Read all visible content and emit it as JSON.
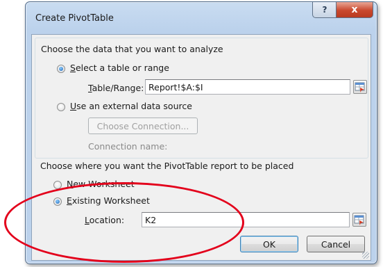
{
  "window": {
    "title": "Create PivotTable",
    "help_glyph": "?",
    "close_glyph": "x"
  },
  "source_section": {
    "heading": "Choose the data that you want to analyze",
    "option_table": {
      "accelerator": "S",
      "label_rest": "elect a table or range",
      "checked": true
    },
    "table_range": {
      "accelerator": "T",
      "label_rest": "able/Range:",
      "value": "Report!$A:$I"
    },
    "option_external": {
      "accelerator": "U",
      "label_rest": "se an external data source",
      "checked": false
    },
    "choose_connection_button": "Choose Connection...",
    "connection_name_label": "Connection name:"
  },
  "placement_section": {
    "heading": "Choose where you want the PivotTable report to be placed",
    "option_new": {
      "accelerator": "N",
      "label_rest": "ew Worksheet",
      "checked": false
    },
    "option_existing": {
      "accelerator": "E",
      "label_rest": "xisting Worksheet",
      "checked": true
    },
    "location": {
      "accelerator": "L",
      "label_rest": "ocation:",
      "value": "K2"
    }
  },
  "buttons": {
    "ok": "OK",
    "cancel": "Cancel"
  },
  "colors": {
    "annotation": "#e3001b",
    "close_button": "#c9482d",
    "title_bar": "#bcd2ec"
  }
}
